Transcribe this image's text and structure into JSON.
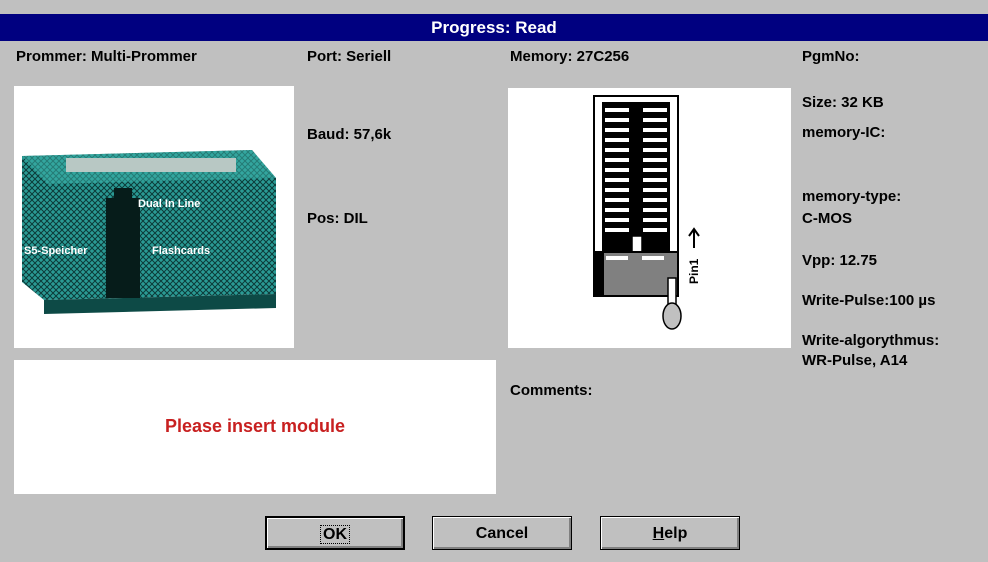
{
  "title": "Progress: Read",
  "left": {
    "prommer": "Prommer: Multi-Prommer",
    "device_labels": [
      "Dual In Line",
      "S5-Speicher",
      "Flashcards"
    ]
  },
  "port": {
    "port": "Port:  Seriell",
    "baud": "Baud: 57,6k",
    "pos": "Pos:  DIL"
  },
  "memory": {
    "memory": "Memory:  27C256",
    "pin_label": "Pin1"
  },
  "info": {
    "pgmno": "PgmNo:",
    "size": "Size:    32 KB",
    "memory_ic": "memory-IC:",
    "memory_type": "memory-type:",
    "memory_type_value": "C-MOS",
    "vpp": "Vpp:    12.75",
    "write_pulse": "Write-Pulse:100 µs",
    "write_algorythmus": "Write-algorythmus:",
    "write_algorythmus_value": "WR-Pulse, A14"
  },
  "message": "Please insert module",
  "comments_label": "Comments:",
  "buttons": {
    "ok": "OK",
    "cancel": "Cancel",
    "help_h": "H",
    "help_rest": "elp"
  },
  "colors": {
    "titlebar": "#000080",
    "message": "#c82020",
    "device": "#2a9a94"
  }
}
